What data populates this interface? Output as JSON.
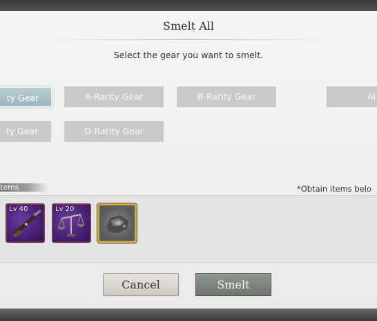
{
  "dialog": {
    "title": "Smelt All",
    "instruction": "Select the gear you want to smelt."
  },
  "gear_filters": [
    {
      "label": "ty Gear",
      "selected": true
    },
    {
      "label": "A-Rarity Gear",
      "selected": false
    },
    {
      "label": "B-Rarity Gear",
      "selected": false
    },
    {
      "label": "Al",
      "selected": false
    },
    {
      "label": "ty Gear",
      "selected": false
    },
    {
      "label": "D-Rarity Gear",
      "selected": false
    }
  ],
  "items_section": {
    "tag": "tems",
    "note": "*Obtain items belo"
  },
  "items": [
    {
      "level": "Lv 40",
      "icon": "musket-icon",
      "frame": "purple"
    },
    {
      "level": "Lv 20",
      "icon": "scales-icon",
      "frame": "purple"
    },
    {
      "level": "",
      "icon": "ore-icon",
      "frame": "gold"
    }
  ],
  "buttons": {
    "cancel": "Cancel",
    "smelt": "Smelt"
  },
  "colors": {
    "selected_filter": "#a9bec4",
    "filter": "#c9c9c9",
    "rare_frame": "#4a237a",
    "gold_frame": "#c9a94e"
  }
}
